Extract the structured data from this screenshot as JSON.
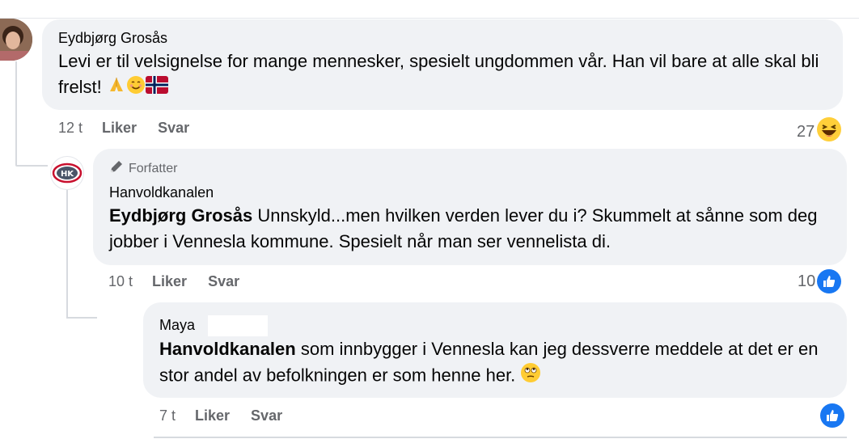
{
  "comments": [
    {
      "author": "Eydbjørg Grosås",
      "text": "Levi er til velsignelse for mange mennesker, spesielt ungdommen vår. Han vil bare at alle skal bli frelst!",
      "emojis": [
        "praying-hands-icon",
        "smiling-face-icon",
        "norway-flag-icon"
      ],
      "time": "12 t",
      "like_label": "Liker",
      "reply_label": "Svar",
      "reaction_count": "27",
      "reaction_type": "haha-icon"
    },
    {
      "badge": "Forfatter",
      "author": "Hanvoldkanalen",
      "mention": "Eydbjørg Grosås",
      "text": " Unnskyld...men hvilken verden lever du i? Skummelt at sånne som deg jobber i Vennesla kommune. Spesielt når man ser vennelista di.",
      "time": "10 t",
      "like_label": "Liker",
      "reply_label": "Svar",
      "reaction_count": "10",
      "reaction_type": "like-icon",
      "avatar_text": "HK"
    },
    {
      "author": "Maya",
      "mention": "Hanvoldkanalen",
      "text": " som innbygger i Vennesla kan jeg dessverre meddele at det er en stor andel av befolkningen er som henne her.",
      "emojis": [
        "rolling-eyes-icon"
      ],
      "time": "7 t",
      "like_label": "Liker",
      "reply_label": "Svar",
      "reaction_type": "like-icon"
    }
  ],
  "colors": {
    "bubble": "#f0f2f5",
    "like_blue": "#1877f2",
    "meta_gray": "#65676b",
    "hk_red": "#c8102e"
  }
}
